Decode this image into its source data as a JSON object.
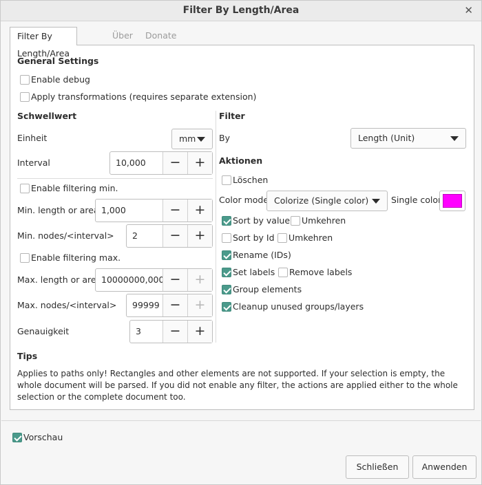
{
  "window": {
    "title": "Filter By Length/Area"
  },
  "tabs": [
    "Filter By Length/Area",
    "Über",
    "Donate"
  ],
  "general": {
    "heading": "General Settings",
    "enable_debug": "Enable debug",
    "apply_transformations": "Apply transformations (requires separate extension)"
  },
  "threshold": {
    "heading": "Schwellwert",
    "unit_label": "Einheit",
    "unit_value": "mm",
    "interval_label": "Interval",
    "interval_value": "10,000",
    "enable_min": "Enable filtering min.",
    "min_length_label": "Min. length or area",
    "min_length_value": "1,000",
    "min_nodes_label": "Min. nodes/<interval>",
    "min_nodes_value": "2",
    "enable_max": "Enable filtering max.",
    "max_length_label": "Max. length or area",
    "max_length_value": "10000000,000",
    "max_nodes_label": "Max. nodes/<interval>",
    "max_nodes_value": "99999",
    "precision_label": "Genauigkeit",
    "precision_value": "3"
  },
  "filter": {
    "heading": "Filter",
    "by_label": "By",
    "by_value": "Length (Unit)"
  },
  "actions": {
    "heading": "Aktionen",
    "delete": "Löschen",
    "color_mode_label": "Color mode",
    "color_mode_value": "Colorize (Single color)",
    "single_color_label": "Single color",
    "single_color_hex": "#ff00ff",
    "sort_by_value": "Sort by value",
    "reverse_1": "Umkehren",
    "sort_by_id": "Sort by Id",
    "reverse_2": "Umkehren",
    "rename_ids": "Rename (IDs)",
    "set_labels": "Set labels",
    "remove_labels": "Remove labels",
    "group_elements": "Group elements",
    "cleanup": "Cleanup unused groups/layers"
  },
  "tips": {
    "heading": "Tips",
    "text": "Applies to paths only! Rectangles and other elements are not supported. If your selection is empty, the whole document will be parsed. If you did not enable any filter, the actions are applied either to the whole selection or the complete document too."
  },
  "footer": {
    "preview": "Vorschau",
    "close": "Schließen",
    "apply": "Anwenden"
  },
  "colors": {
    "accent": "#4b9a8b",
    "swatch": "#ff00ff"
  }
}
